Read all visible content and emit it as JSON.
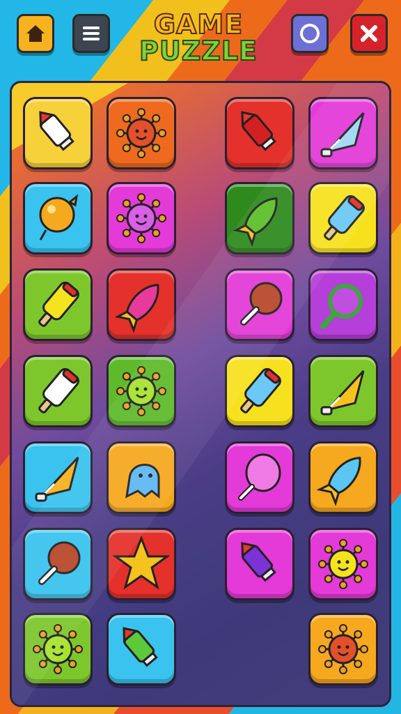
{
  "title": {
    "line1": "GAME",
    "line2": "PUZZLE"
  },
  "header": {
    "home_icon": "home-icon",
    "menu_icon": "hamburger-menu-icon",
    "circle_icon": "circle-icon",
    "close_icon": "close-x-icon"
  },
  "colors": {
    "yellow": "#f7d21e",
    "orange": "#f68b1f",
    "red": "#e4312b",
    "magenta": "#e33ad8",
    "cyan": "#39c3ee",
    "lime": "#7dc72c",
    "darkgreen": "#2f8a1e",
    "purple": "#b53fd8"
  },
  "tiles": [
    {
      "color": "#f6d13a",
      "item": "paint-tube-white"
    },
    {
      "color": "#ef6a1e",
      "item": "virus-orange"
    },
    {
      "color": "#e4312b",
      "item": "paint-tube-red"
    },
    {
      "color": "#e33ad8",
      "item": "crystal-shard-blue"
    },
    {
      "color": "#39c3ee",
      "item": "balloon-orange"
    },
    {
      "color": "#e33ad8",
      "item": "virus-magenta"
    },
    {
      "color": "#2f8a1e",
      "item": "rocket-green"
    },
    {
      "color": "#f7e11e",
      "item": "ice-pop-blue"
    },
    {
      "color": "#7dc72c",
      "item": "ice-pop-yellow"
    },
    {
      "color": "#e4312b",
      "item": "rocket-pink"
    },
    {
      "color": "#e33ad8",
      "item": "drumstick"
    },
    {
      "color": "#b53fd8",
      "item": "magnifier-ring"
    },
    {
      "color": "#7dc72c",
      "item": "ice-pop-white"
    },
    {
      "color": "#5fba2b",
      "item": "virus-lime"
    },
    {
      "color": "#f7e11e",
      "item": "ice-pop-blue"
    },
    {
      "color": "#7dc72c",
      "item": "crystal-shard-yellow"
    },
    {
      "color": "#39c3ee",
      "item": "crystal-shard-orange"
    },
    {
      "color": "#f6a81f",
      "item": "ghost-blue"
    },
    {
      "color": "#e33ad8",
      "item": "lollipop-pink"
    },
    {
      "color": "#f6a81f",
      "item": "rocket-blue"
    },
    {
      "color": "#39c3ee",
      "item": "drumstick"
    },
    {
      "color": "#e4312b",
      "item": "star-yellow"
    },
    {
      "color": "#e33ad8",
      "item": "paint-tube-purple"
    },
    {
      "color": "#e33ad8",
      "item": "virus-yellow"
    },
    {
      "color": "#7dc72c",
      "item": "virus-lime"
    },
    {
      "color": "#39c3ee",
      "item": "paint-tube-green"
    },
    {
      "color": "#f6a81f",
      "item": "virus-orange"
    }
  ]
}
